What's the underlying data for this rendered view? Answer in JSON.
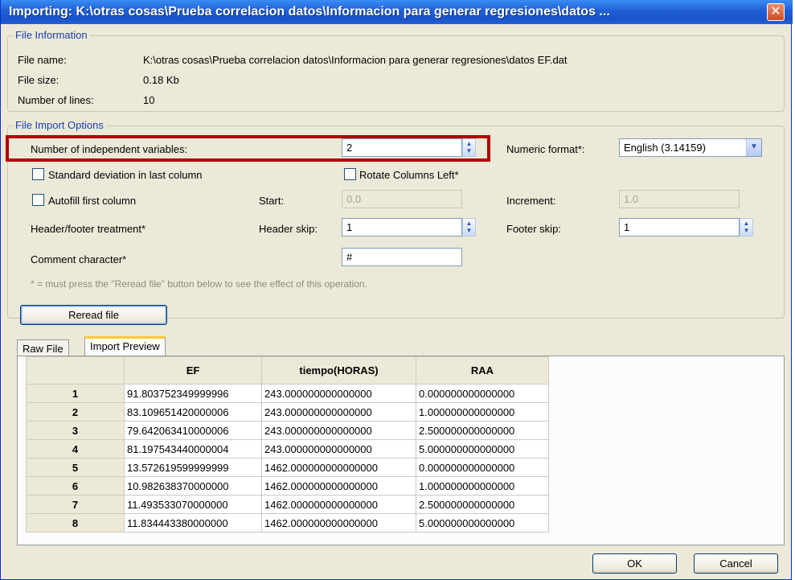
{
  "window": {
    "title": "Importing: K:\\otras cosas\\Prueba correlacion datos\\Informacion para generar regresiones\\datos ...",
    "close_glyph": "✕"
  },
  "file_information": {
    "legend": "File Information",
    "file_name_label": "File name:",
    "file_name": "K:\\otras cosas\\Prueba correlacion datos\\Informacion para generar regresiones\\datos EF.dat",
    "file_size_label": "File size:",
    "file_size": "0.18 Kb",
    "num_lines_label": "Number of lines:",
    "num_lines": "10"
  },
  "import_options": {
    "legend": "File Import Options",
    "indep_vars_label": "Number of independent variables:",
    "indep_vars_value": "2",
    "numeric_format_label": "Numeric format*:",
    "numeric_format_value": "English (3.14159)",
    "std_dev_label": "Standard deviation in last column",
    "rotate_label": "Rotate Columns Left*",
    "autofill_label": "Autofill first column",
    "start_label": "Start:",
    "start_value": "0.0",
    "increment_label": "Increment:",
    "increment_value": "1.0",
    "header_footer_label": "Header/footer treatment*",
    "header_skip_label": "Header skip:",
    "header_skip_value": "1",
    "footer_skip_label": "Footer skip:",
    "footer_skip_value": "1",
    "comment_label": "Comment character*",
    "comment_value": "#",
    "note": "* = must press the \"Reread file\" button below to see the effect of this operation."
  },
  "reread_button": "Reread file",
  "tabs": [
    "Raw File",
    "Import Preview"
  ],
  "table": {
    "columns": [
      "EF",
      "tiempo(HORAS)",
      "RAA"
    ],
    "rows": [
      {
        "n": "1",
        "ef": "91.803752349999996",
        "t": "243.000000000000000",
        "raa": "0.000000000000000"
      },
      {
        "n": "2",
        "ef": "83.109651420000006",
        "t": "243.000000000000000",
        "raa": "1.000000000000000"
      },
      {
        "n": "3",
        "ef": "79.642063410000006",
        "t": "243.000000000000000",
        "raa": "2.500000000000000"
      },
      {
        "n": "4",
        "ef": "81.197543440000004",
        "t": "243.000000000000000",
        "raa": "5.000000000000000"
      },
      {
        "n": "5",
        "ef": "13.572619599999999",
        "t": "1462.000000000000000",
        "raa": "0.000000000000000"
      },
      {
        "n": "6",
        "ef": "10.982638370000000",
        "t": "1462.000000000000000",
        "raa": "1.000000000000000"
      },
      {
        "n": "7",
        "ef": "11.493533070000000",
        "t": "1462.000000000000000",
        "raa": "2.500000000000000"
      },
      {
        "n": "8",
        "ef": "11.834443380000000",
        "t": "1462.000000000000000",
        "raa": "5.000000000000000"
      }
    ]
  },
  "buttons": {
    "ok": "OK",
    "cancel": "Cancel"
  },
  "colors": {
    "title_bar": "#1f5fd6",
    "highlight": "#b00000",
    "legend_text": "#1b3fae"
  }
}
